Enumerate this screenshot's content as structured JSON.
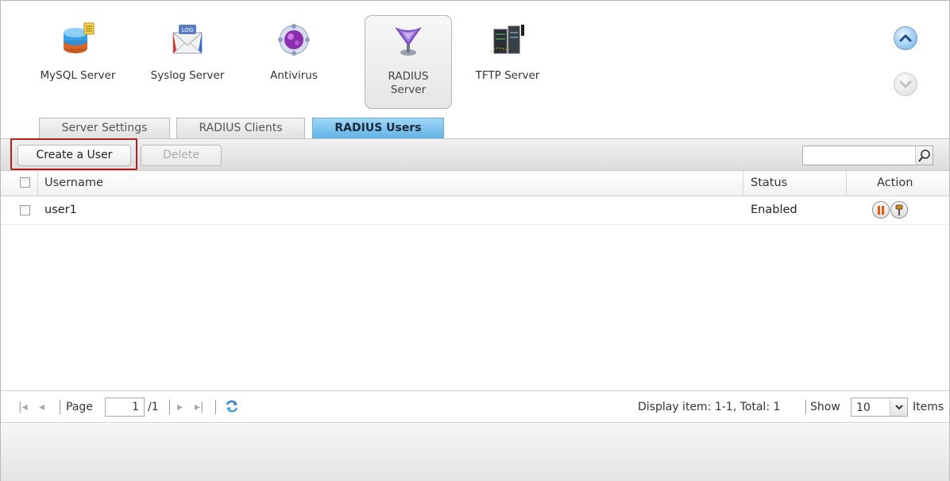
{
  "apps": [
    {
      "label": "MySQL Server",
      "icon": "database-icon"
    },
    {
      "label": "Syslog Server",
      "icon": "log-envelope-icon"
    },
    {
      "label": "Antivirus",
      "icon": "virus-icon"
    },
    {
      "label_line1": "RADIUS",
      "label_line2": "Server",
      "icon": "radius-antenna-icon",
      "active": true
    },
    {
      "label": "TFTP Server",
      "icon": "server-rack-icon"
    }
  ],
  "tabs": [
    {
      "label": "Server Settings"
    },
    {
      "label": "RADIUS Clients"
    },
    {
      "label": "RADIUS Users",
      "active": true
    }
  ],
  "toolbar": {
    "create_label": "Create a User",
    "delete_label": "Delete",
    "search_value": ""
  },
  "grid": {
    "headers": {
      "username": "Username",
      "status": "Status",
      "action": "Action"
    },
    "rows": [
      {
        "username": "user1",
        "status": "Enabled"
      }
    ]
  },
  "pager": {
    "page_label": "Page",
    "page_value": "1",
    "total_pages": "/1",
    "display_text": "Display item: 1-1, Total: 1",
    "show_label": "Show",
    "show_value": "10",
    "items_label": "Items"
  },
  "colors": {
    "active_tab": "#5fb2e6",
    "highlight": "#b02020",
    "pause": "#e45a12"
  }
}
